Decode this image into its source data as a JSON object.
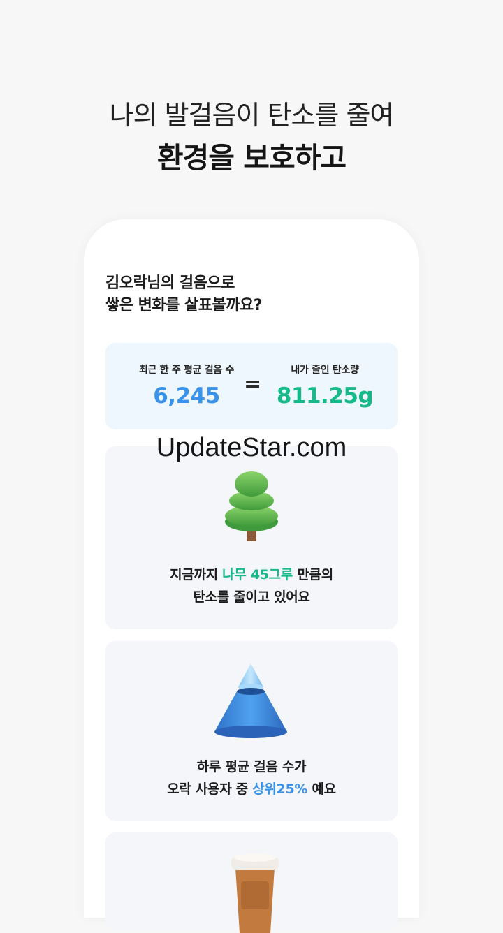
{
  "headline": {
    "line1": "나의 발걸음이 탄소를 줄여",
    "line2": "환경을 보호하고"
  },
  "intro": {
    "line1": "김오락님의 걸음으로",
    "line2": "쌓은 변화를 살표볼까요?"
  },
  "stats": {
    "left_label": "최근 한 주 평균 걸음 수",
    "left_value": "6,245",
    "equals": "=",
    "right_label": "내가 줄인 탄소량",
    "right_value": "811.25g"
  },
  "tree_card": {
    "pre": "지금까지 ",
    "highlight": "나무 45그루",
    "post": " 만큼의",
    "line2": "탄소를 줄이고 있어요",
    "icon": "tree-icon"
  },
  "rank_card": {
    "line1": "하루 평균 걸음 수가",
    "pre": "오락 사용자 중 ",
    "highlight": "상위25%",
    "post": " 예요",
    "icon": "pyramid-icon"
  },
  "cup_card": {
    "icon": "coffee-cup-icon"
  },
  "watermark": "UpdateStar.com",
  "colors": {
    "background": "#f7f7f8",
    "stats_bg": "#eef6fe",
    "card_bg": "#f4f6fa",
    "accent_blue": "#3a93ea",
    "accent_green": "#17b889"
  }
}
